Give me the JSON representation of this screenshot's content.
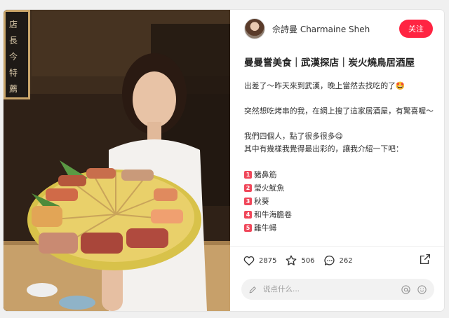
{
  "author": {
    "name": "佘詩曼 Charmaine Sheh",
    "follow_label": "关注"
  },
  "post": {
    "title": "曼曼嘗美食｜武漢探店｜炭火燒鳥居酒屋",
    "paragraphs": [
      "出差了～昨天來到武漢，晚上當然去找吃的了🤩",
      "突然想吃烤串的我，在網上搜了這家居酒屋，有驚喜喔～",
      "我們四個人，點了很多很多😋",
      "其中有幾樣我覺得最出彩的，讓我介紹一下吧："
    ],
    "list": [
      {
        "num": "1",
        "text": "豬鼻筋"
      },
      {
        "num": "2",
        "text": "瑩火魷魚"
      },
      {
        "num": "3",
        "text": "秋葵"
      },
      {
        "num": "4",
        "text": "和牛海膽卷"
      },
      {
        "num": "5",
        "text": "雞牛蟳"
      }
    ]
  },
  "stats": {
    "likes": "2875",
    "favorites": "506",
    "comments": "262"
  },
  "comment_box": {
    "placeholder": "说点什么..."
  },
  "icons": [
    "heart-icon",
    "star-icon",
    "comment-icon",
    "share-icon",
    "pencil-icon",
    "at-icon",
    "smile-icon"
  ],
  "colors": {
    "accent": "#ff2442"
  }
}
